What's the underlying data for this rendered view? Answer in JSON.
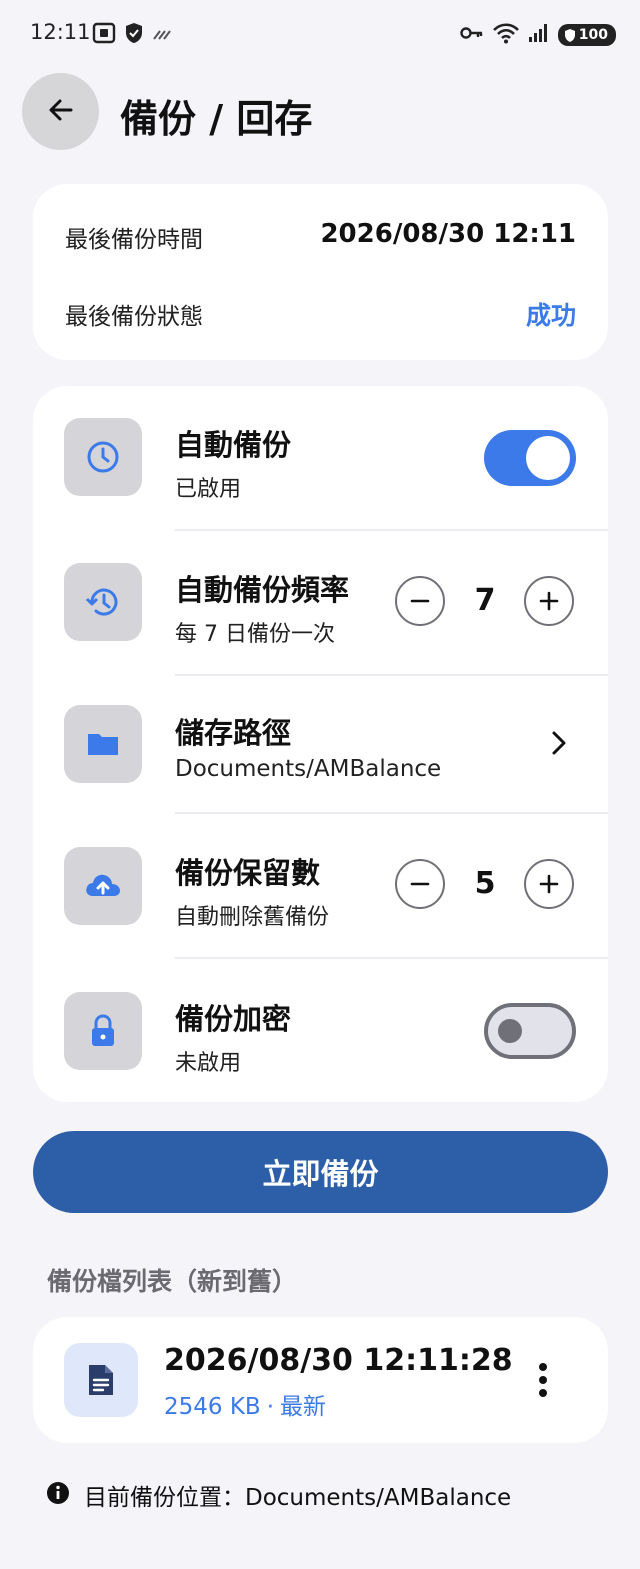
{
  "status_bar": {
    "time": "12:11",
    "battery": "100"
  },
  "header": {
    "title": "備份 / 回存"
  },
  "summary": {
    "last_backup_time_label": "最後備份時間",
    "last_backup_time_value": "2026/08/30 12:11",
    "last_backup_status_label": "最後備份狀態",
    "last_backup_status_value": "成功",
    "status_color": "#3b7ae8"
  },
  "settings": {
    "auto_backup": {
      "title": "自動備份",
      "subtitle": "已啟用",
      "enabled": true,
      "icon": "clock-icon"
    },
    "frequency": {
      "title": "自動備份頻率",
      "subtitle": "每 7 日備份一次",
      "value": "7",
      "icon": "history-icon"
    },
    "storage_path": {
      "title": "儲存路徑",
      "subtitle": "Documents/AMBalance",
      "icon": "folder-icon"
    },
    "retention": {
      "title": "備份保留數",
      "subtitle": "自動刪除舊備份",
      "value": "5",
      "icon": "cloud-upload-icon"
    },
    "encryption": {
      "title": "備份加密",
      "subtitle": "未啟用",
      "enabled": false,
      "icon": "lock-icon"
    }
  },
  "actions": {
    "backup_now_label": "立即備份",
    "accent_color": "#2d5ea8"
  },
  "backup_list": {
    "section_title": "備份檔列表（新到舊）",
    "items": [
      {
        "name": "2026/08/30 12:11:28",
        "size": "2546 KB",
        "tag": "最新",
        "icon": "document-icon"
      }
    ]
  },
  "footer": {
    "note": "目前備份位置：Documents/AMBalance",
    "icon": "info-icon"
  }
}
